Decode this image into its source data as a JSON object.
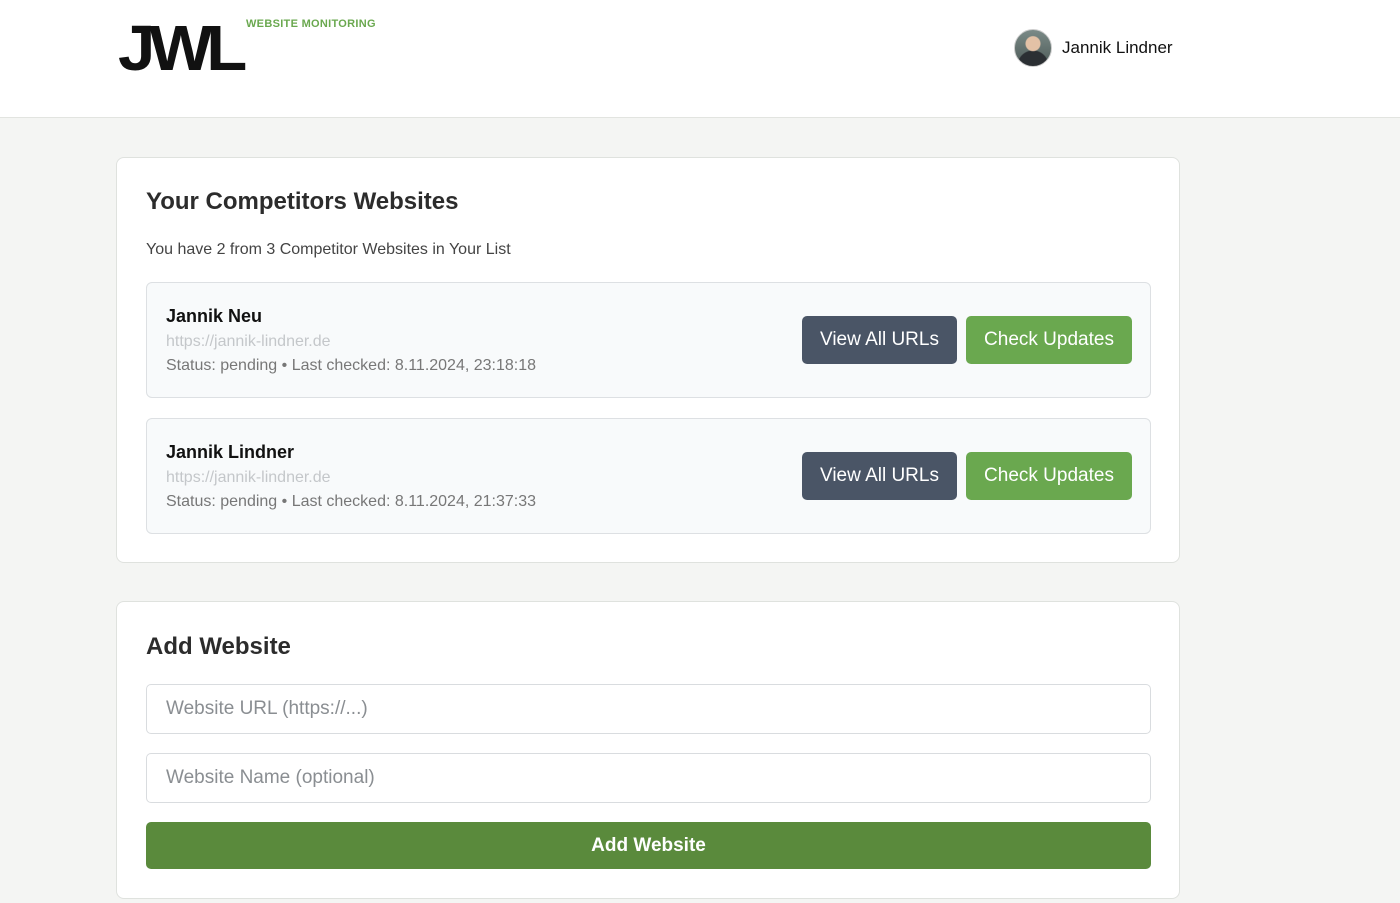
{
  "header": {
    "logo_text": "JWL",
    "logo_subtitle": "WEBSITE MONITORING",
    "user_name": "Jannik Lindner"
  },
  "competitors": {
    "title": "Your Competitors Websites",
    "summary": "You have 2 from 3 Competitor Websites in Your List",
    "sites": [
      {
        "name": "Jannik Neu",
        "url": "https://jannik-lindner.de",
        "status_line": "Status: pending • Last checked: 8.11.2024, 23:18:18",
        "view_label": "View All URLs",
        "check_label": "Check Updates"
      },
      {
        "name": "Jannik Lindner",
        "url": "https://jannik-lindner.de",
        "status_line": "Status: pending • Last checked: 8.11.2024, 21:37:33",
        "view_label": "View All URLs",
        "check_label": "Check Updates"
      }
    ]
  },
  "add_website": {
    "title": "Add Website",
    "url_placeholder": "Website URL (https://...)",
    "url_value": "",
    "name_placeholder": "Website Name (optional)",
    "name_value": "",
    "submit_label": "Add Website"
  },
  "colors": {
    "accent_green": "#6aa84f",
    "submit_green": "#5a8a3c",
    "view_button": "#4a5566"
  }
}
